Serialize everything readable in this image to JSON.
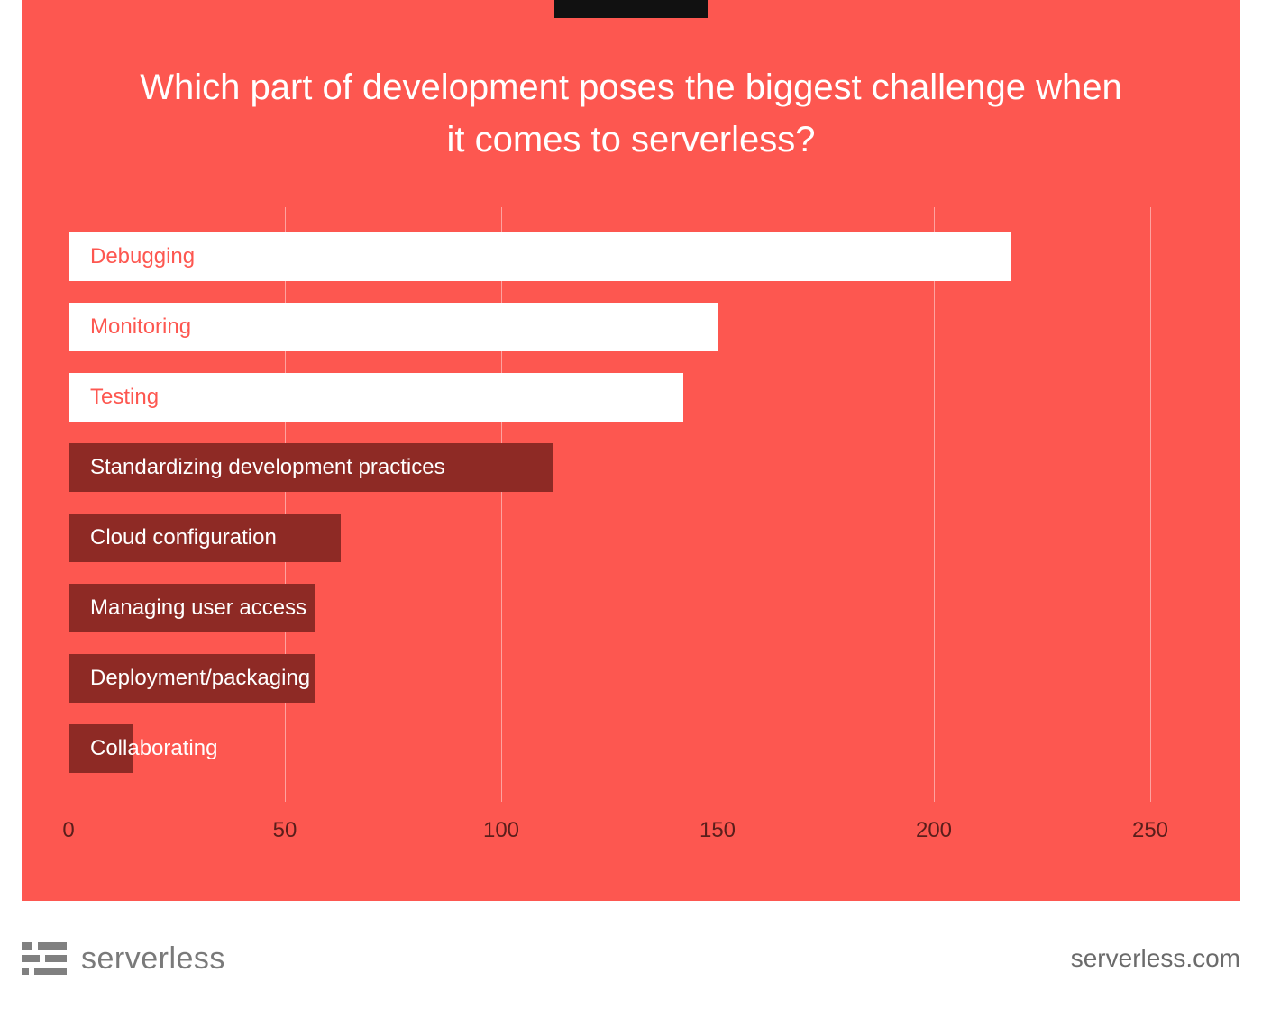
{
  "title": "Which part of development poses the biggest challenge when it comes to serverless?",
  "chart_data": {
    "type": "bar",
    "orientation": "horizontal",
    "categories": [
      "Debugging",
      "Monitoring",
      "Testing",
      "Standardizing development practices",
      "Cloud configuration",
      "Managing user access",
      "Deployment/packaging",
      "Collaborating"
    ],
    "values": [
      218,
      150,
      142,
      112,
      63,
      57,
      57,
      15
    ],
    "highlight_top_n": 3,
    "xlim": [
      0,
      250
    ],
    "xticks": [
      0,
      50,
      100,
      150,
      200,
      250
    ],
    "ylabel": "",
    "xlabel": "",
    "colors": {
      "top": "#ffffff",
      "rest": "#8E2A25",
      "top_label": "#FD5750",
      "rest_label": "#ffffff",
      "background": "#FD5750"
    }
  },
  "footer": {
    "brand_text": "serverless",
    "brand_url": "serverless.com"
  }
}
